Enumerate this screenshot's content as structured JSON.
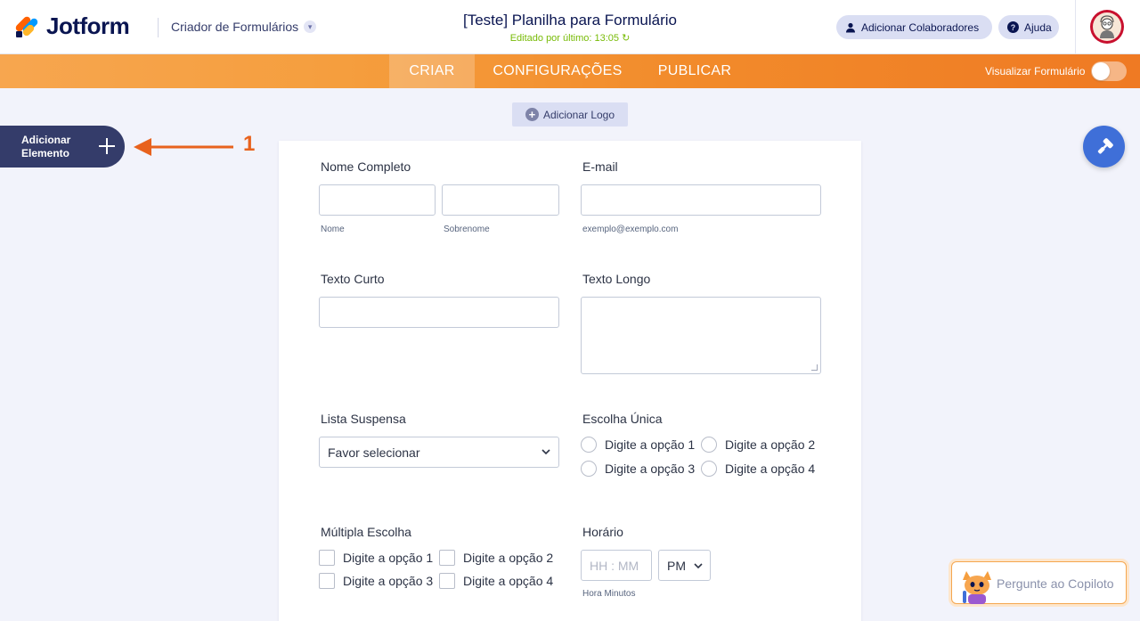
{
  "header": {
    "logo_text": "Jotform",
    "builder_label": "Criador de Formulários",
    "form_title": "[Teste] Planilha para Formulário",
    "edited_text": "Editado por último: 13:05",
    "collaborators_label": "Adicionar Colaboradores",
    "help_label": "Ajuda"
  },
  "nav": {
    "tabs": [
      {
        "label": "CRIAR",
        "active": true
      },
      {
        "label": "CONFIGURAÇÕES",
        "active": false
      },
      {
        "label": "PUBLICAR",
        "active": false
      }
    ],
    "preview_label": "Visualizar Formulário",
    "preview_enabled": false
  },
  "sidebar": {
    "add_element_label": "Adicionar Elemento"
  },
  "annotation": {
    "number": "1",
    "color": "#e8621d"
  },
  "form": {
    "add_logo_label": "Adicionar Logo",
    "fields": {
      "full_name": {
        "label": "Nome Completo",
        "first_sublabel": "Nome",
        "last_sublabel": "Sobrenome"
      },
      "email": {
        "label": "E-mail",
        "sublabel": "exemplo@exemplo.com"
      },
      "short_text": {
        "label": "Texto Curto"
      },
      "long_text": {
        "label": "Texto Longo"
      },
      "dropdown": {
        "label": "Lista Suspensa",
        "selected": "Favor selecionar"
      },
      "single_choice": {
        "label": "Escolha Única",
        "options": [
          "Digite a opção 1",
          "Digite a opção 2",
          "Digite a opção 3",
          "Digite a opção 4"
        ]
      },
      "multiple_choice": {
        "label": "Múltipla Escolha",
        "options": [
          "Digite a opção 1",
          "Digite a opção 2",
          "Digite a opção 3",
          "Digite a opção 4"
        ]
      },
      "time": {
        "label": "Horário",
        "placeholder": "HH : MM",
        "ampm": "PM",
        "sublabel": "Hora Minutos"
      }
    }
  },
  "copilot": {
    "label": "Pergunte ao Copiloto"
  },
  "colors": {
    "brand_navy": "#0a1551",
    "nav_orange": "#f28b2b",
    "edited_green": "#78bb07",
    "paint_blue": "#3f6fd8"
  },
  "icons": [
    "user-icon",
    "help-icon",
    "refresh-icon",
    "plus-icon",
    "paint-roller-icon",
    "chevron-down-icon",
    "copilot-mascot-icon"
  ]
}
